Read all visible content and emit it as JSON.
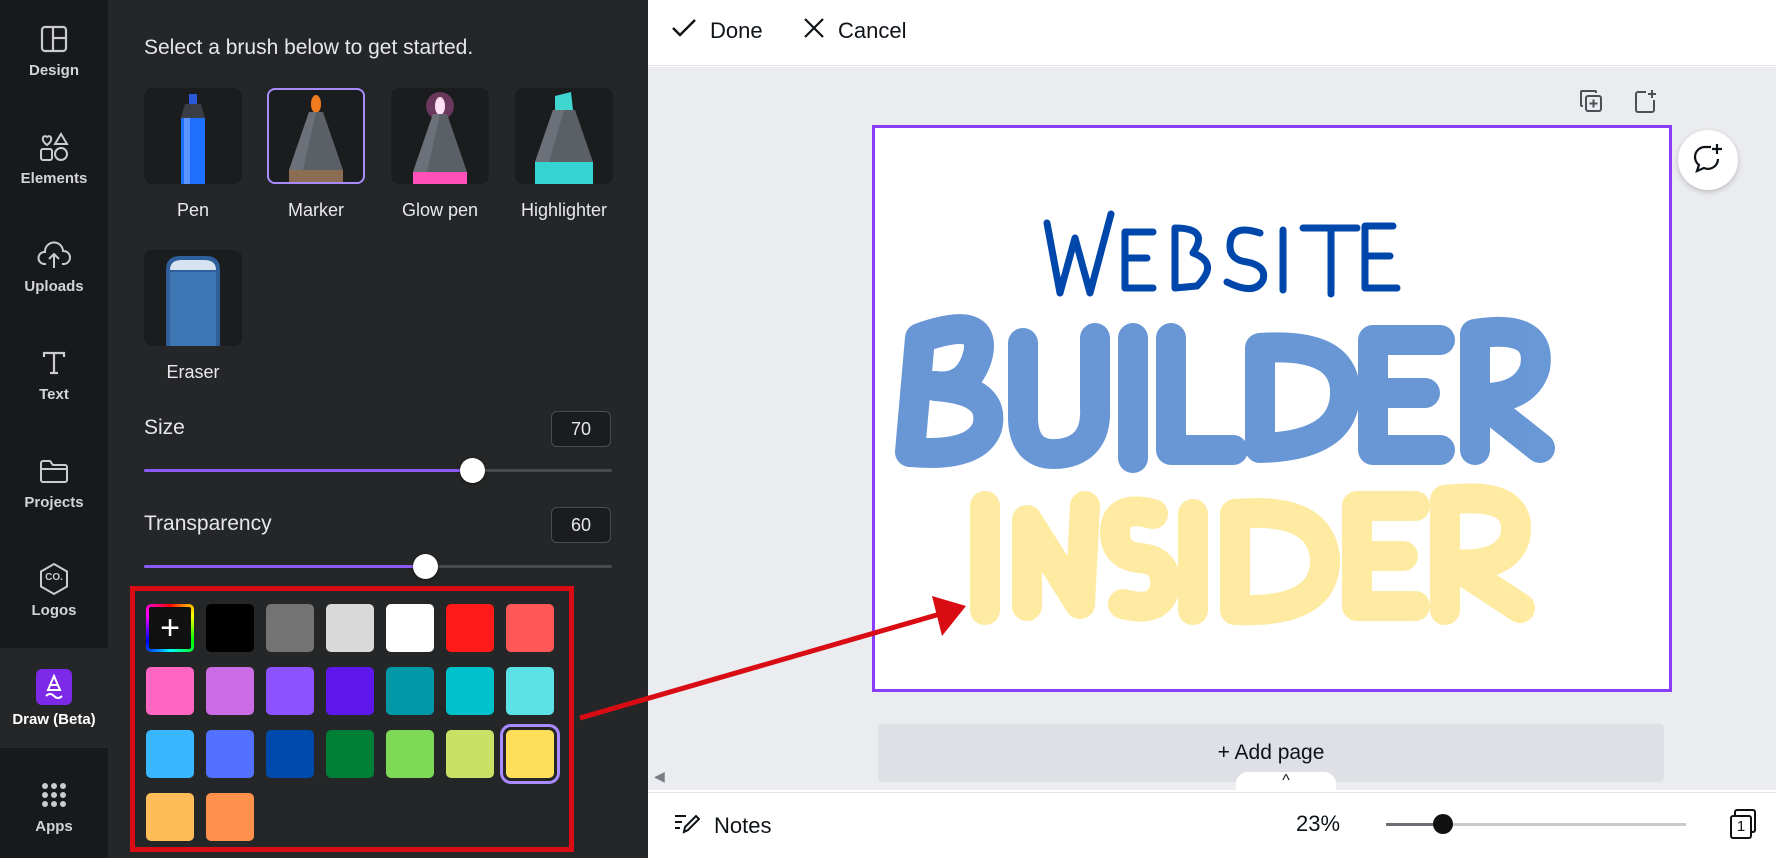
{
  "rail": {
    "items": [
      {
        "label": "Design",
        "icon": "layout-icon"
      },
      {
        "label": "Elements",
        "icon": "shapes-icon"
      },
      {
        "label": "Uploads",
        "icon": "cloud-upload-icon"
      },
      {
        "label": "Text",
        "icon": "text-icon"
      },
      {
        "label": "Projects",
        "icon": "folder-icon"
      },
      {
        "label": "Logos",
        "icon": "logo-badge-icon"
      },
      {
        "label": "Draw (Beta)",
        "icon": "draw-icon"
      },
      {
        "label": "Apps",
        "icon": "apps-grid-icon"
      }
    ],
    "logo_badge_text": "CO."
  },
  "panel": {
    "title": "Select a brush below to get started.",
    "brushes": [
      {
        "label": "Pen",
        "active": false
      },
      {
        "label": "Marker",
        "active": true
      },
      {
        "label": "Glow pen",
        "active": false
      },
      {
        "label": "Highlighter",
        "active": false
      },
      {
        "label": "Eraser",
        "active": false
      }
    ],
    "size": {
      "label": "Size",
      "value": "70",
      "fraction": 0.7
    },
    "transparency": {
      "label": "Transparency",
      "value": "60",
      "fraction": 0.6
    },
    "palette": {
      "add_glyph": "+",
      "colors": [
        "#000000",
        "#737373",
        "#d9d9d9",
        "#ffffff",
        "#ff1a1a",
        "#ff5757",
        "#ff66c4",
        "#cb6ce6",
        "#8c52ff",
        "#5e17eb",
        "#0097a7",
        "#00c2cb",
        "#5ce1e6",
        "#38b6ff",
        "#5271ff",
        "#004aad",
        "#008037",
        "#7ed957",
        "#c9e265",
        "#ffde59",
        "#ffbd59",
        "#ff914d"
      ],
      "selected": "#ffde59"
    }
  },
  "topbar": {
    "done_label": "Done",
    "cancel_label": "Cancel"
  },
  "canvas": {
    "drawing_text": [
      "WEBSITE",
      "BUILDER",
      "INSIDER"
    ],
    "drawing_colors": {
      "website": "#0047ab",
      "builder": "#4f86d0",
      "insider": "#ffe27a"
    },
    "page_border_color": "#8b3dff",
    "add_page_label": "+ Add page",
    "expand_glyph": "^"
  },
  "bottombar": {
    "notes_label": "Notes",
    "zoom_label": "23%",
    "zoom_fraction": 0.19,
    "page_count": "1"
  },
  "annotation": {
    "highlight_color": "#d90c14"
  }
}
